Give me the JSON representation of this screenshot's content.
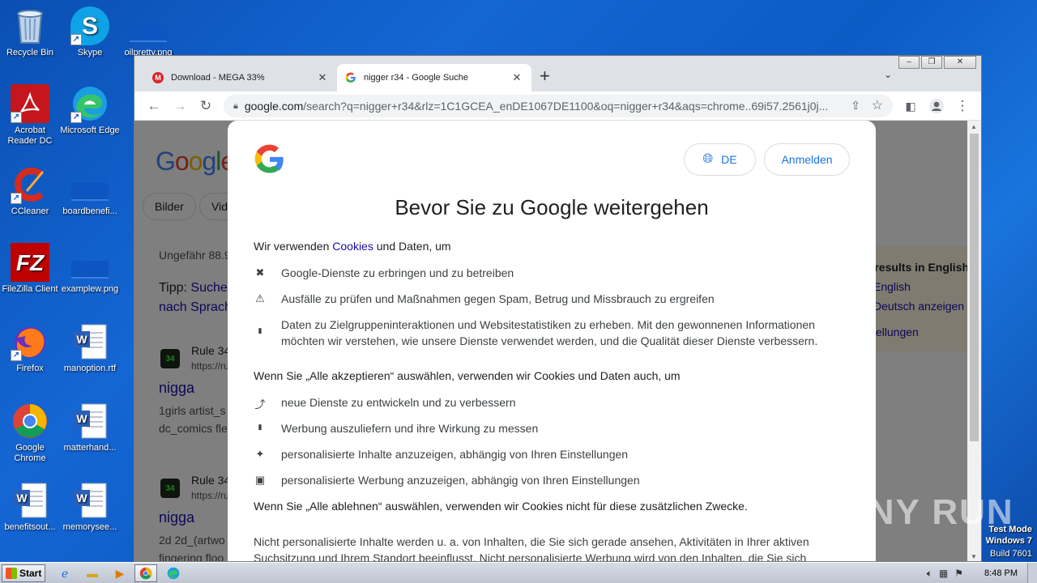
{
  "desktop": {
    "icons": [
      {
        "label": "Recycle Bin"
      },
      {
        "label": "Skype"
      },
      {
        "label": "oilpretty.png"
      },
      {
        "label": "Acrobat Reader DC"
      },
      {
        "label": "Microsoft Edge"
      },
      {
        "label": "CCleaner"
      },
      {
        "label": "boardbenefi..."
      },
      {
        "label": "FileZilla Client"
      },
      {
        "label": "examplew.png"
      },
      {
        "label": "Firefox"
      },
      {
        "label": "manoption.rtf"
      },
      {
        "label": "Google Chrome"
      },
      {
        "label": "matterhand..."
      },
      {
        "label": "benefitsout..."
      },
      {
        "label": "memorysee..."
      }
    ]
  },
  "browser": {
    "tabs": [
      {
        "title": "Download - MEGA 33%",
        "favicon": "mega-icon",
        "active": false
      },
      {
        "title": "nigger r34 - Google Suche",
        "favicon": "google-icon",
        "active": true
      }
    ],
    "new_tab_label": "+",
    "address": {
      "domain": "google.com",
      "path": "/search?q=nigger+r34&rlz=1C1GCEA_enDE1067DE1100&oq=nigger+r34&aqs=chrome..69i57.2561j0j..."
    },
    "window_controls": [
      "–",
      "❐",
      "✕"
    ]
  },
  "background_page": {
    "chips": [
      "Bilder",
      "Vid"
    ],
    "result_count": "Ungefähr 88.9",
    "tip_prefix": "Tipp: ",
    "tip_link": "Suche",
    "tip_link2": "nach Sprach",
    "results": [
      {
        "site": "Rule 34",
        "url": "https://ru",
        "title": "nigga",
        "snippet1": "1girls artist_s",
        "snippet2": "dc_comics fle"
      },
      {
        "site": "Rule 34",
        "url": "https://ru",
        "title": "nigga",
        "snippet1": "2d 2d_(artwo",
        "snippet2": "fingering floo"
      }
    ],
    "notice": {
      "heading": "r results in English",
      "line1": "English",
      "line2": "Deutsch anzeigen",
      "line3": "stellungen"
    }
  },
  "consent": {
    "lang_label": "DE",
    "login_label": "Anmelden",
    "title": "Bevor Sie zu Google weitergehen",
    "intro_before": "Wir verwenden ",
    "intro_link": "Cookies",
    "intro_after": " und Daten, um",
    "basic_items": [
      {
        "icon": "tools-icon",
        "glyph": "✖",
        "text": "Google-Dienste zu erbringen und zu betreiben"
      },
      {
        "icon": "warning-icon",
        "glyph": "⚠",
        "text": "Ausfälle zu prüfen und Maßnahmen gegen Spam, Betrug und Missbrauch zu ergreifen"
      },
      {
        "icon": "bar-chart-icon",
        "glyph": "▮",
        "text": "Daten zu Zielgruppeninteraktionen und Websitestatistiken zu erheben. Mit den gewonnenen Informationen möchten wir verstehen, wie unsere Dienste verwendet werden, und die Qualität dieser Dienste verbessern."
      }
    ],
    "accept_heading": "Wenn Sie „Alle akzeptieren“ auswählen, verwenden wir Cookies und Daten auch, um",
    "accept_items": [
      {
        "icon": "trend-icon",
        "glyph": "⤴",
        "text": "neue Dienste zu entwickeln und zu verbessern"
      },
      {
        "icon": "bar-chart-icon",
        "glyph": "▮",
        "text": "Werbung auszuliefern und ihre Wirkung zu messen"
      },
      {
        "icon": "sparkle-icon",
        "glyph": "✦",
        "text": "personalisierte Inhalte anzuzeigen, abhängig von Ihren Einstellungen"
      },
      {
        "icon": "ad-icon",
        "glyph": "▣",
        "text": "personalisierte Werbung anzuzeigen, abhängig von Ihren Einstellungen"
      }
    ],
    "reject_text": "Wenn Sie „Alle ablehnen“ auswählen, verwenden wir Cookies nicht für diese zusätzlichen Zwecke.",
    "footer_line1": "Nicht personalisierte Inhalte werden u. a. von Inhalten, die Sie sich gerade ansehen, Aktivitäten in Ihrer aktiven",
    "footer_line2": "Suchsitzung und Ihrem Standort beeinflusst. Nicht personalisierte Werbung wird von den Inhalten, die Sie sich"
  },
  "taskbar": {
    "start_label": "Start",
    "clock": "8:48 PM"
  },
  "watermark": "ANY RUN",
  "os_info": {
    "line1": "Test Mode",
    "line2": "Windows 7",
    "line3": "Build 7601"
  },
  "colors": {
    "link": "#1a0dab",
    "accent": "#1a73e8",
    "google_blue": "#4285f4",
    "google_red": "#ea4335",
    "google_yellow": "#fbbc05",
    "google_green": "#34a853"
  }
}
